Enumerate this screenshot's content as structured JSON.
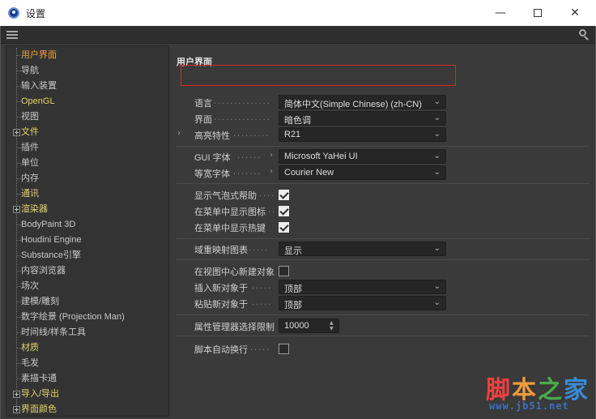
{
  "window": {
    "title": "设置",
    "minimize_glyph": "—",
    "close_glyph": "✕"
  },
  "sidebar": {
    "items": [
      {
        "label": "用户界面",
        "state": "active"
      },
      {
        "label": "导航"
      },
      {
        "label": "输入装置"
      },
      {
        "label": "OpenGL",
        "state": "yellow"
      },
      {
        "label": "视图"
      },
      {
        "label": "文件",
        "expandable": true,
        "state": "yellow"
      },
      {
        "label": "插件"
      },
      {
        "label": "单位"
      },
      {
        "label": "内存"
      },
      {
        "label": "通讯",
        "state": "yellow"
      },
      {
        "label": "渲染器",
        "expandable": true,
        "state": "yellow"
      },
      {
        "label": "BodyPaint 3D"
      },
      {
        "label": "Houdini Engine"
      },
      {
        "label": "Substance引擎"
      },
      {
        "label": "内容浏览器"
      },
      {
        "label": "场次"
      },
      {
        "label": "建模/雕刻"
      },
      {
        "label": "数字绘景 (Projection Man)"
      },
      {
        "label": "时间线/样条工具"
      },
      {
        "label": "材质",
        "state": "yellow"
      },
      {
        "label": "毛发"
      },
      {
        "label": "素描卡通"
      },
      {
        "label": "导入/导出",
        "expandable": true,
        "state": "yellow"
      },
      {
        "label": "界面颜色",
        "expandable": true,
        "state": "yellow"
      }
    ]
  },
  "content": {
    "section_title": "用户界面",
    "language": {
      "label": "语言",
      "value": "简体中文(Simple Chinese) (zh-CN)"
    },
    "scheme": {
      "label": "界面",
      "value": "暗色调"
    },
    "highlight": {
      "label": "高亮特性",
      "value": "R21"
    },
    "gui_font": {
      "label": "GUI 字体",
      "value": "Microsoft YaHei UI"
    },
    "mono_font": {
      "label": "等宽字体",
      "value": "Courier New"
    },
    "bubble_help": {
      "label": "显示气泡式帮助",
      "checked": true
    },
    "menu_icons": {
      "label": "在菜单中显示图标",
      "checked": true
    },
    "menu_hotkeys": {
      "label": "在菜单中显示热键",
      "checked": true
    },
    "field_icons": {
      "label": "域重映射图表",
      "value": "显示"
    },
    "new_object_center": {
      "label": "在视图中心新建对象",
      "checked": false
    },
    "insert_new": {
      "label": "插入新对象于",
      "value": "顶部"
    },
    "paste_new": {
      "label": "粘贴新对象于",
      "value": "顶部"
    },
    "attr_limit": {
      "label": "属性管理器选择限制",
      "value": "10000"
    },
    "script_wrap": {
      "label": "脚本自动换行",
      "checked": false
    }
  },
  "watermark": {
    "chars": [
      "脚",
      "本",
      "之",
      "家"
    ],
    "url": "www.jb51.net"
  }
}
